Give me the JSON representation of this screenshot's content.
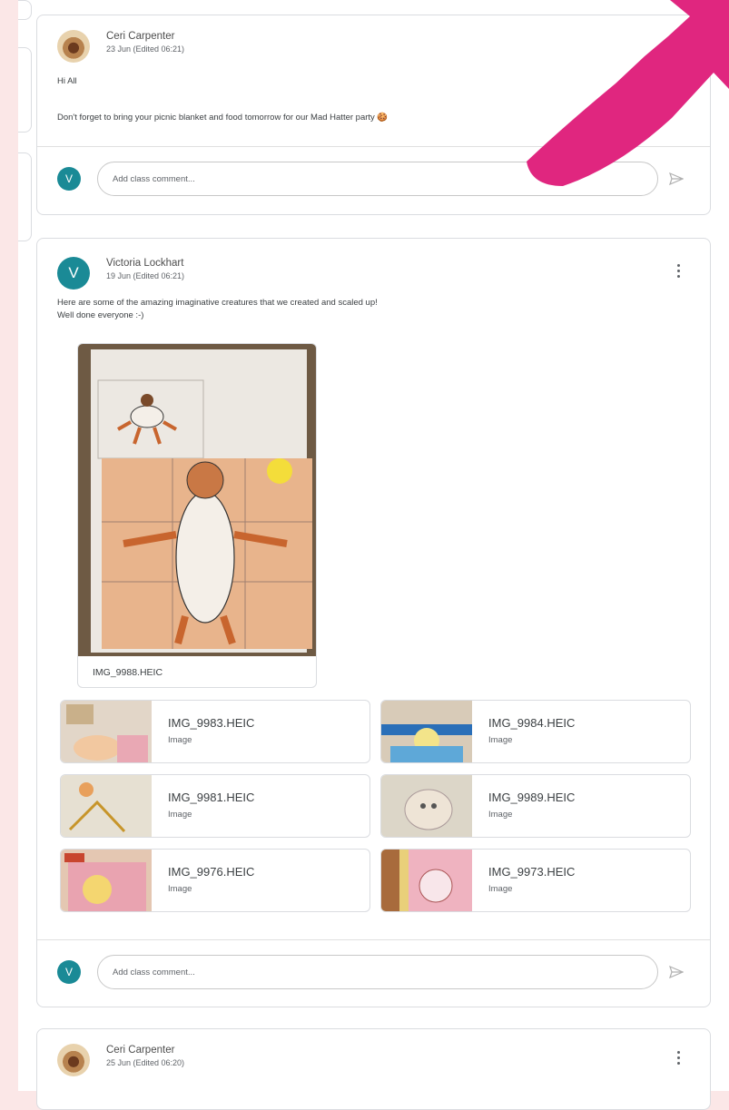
{
  "posts": [
    {
      "author": "Ceri Carpenter",
      "date": "23 Jun (Edited 06:21)",
      "lines": [
        "Hi All",
        "Don't forget to bring your picnic blanket and food tomorrow for our Mad Hatter party 🍪"
      ]
    },
    {
      "author": "Victoria Lockhart",
      "avatar_letter": "V",
      "date": "19 Jun (Edited 06:21)",
      "lines": [
        "Here are some of the amazing imaginative creatures that we created and scaled up!",
        "Well done everyone :-)"
      ],
      "main_attachment": "IMG_9988.HEIC",
      "attachments": [
        {
          "name": "IMG_9983.HEIC",
          "kind": "Image"
        },
        {
          "name": "IMG_9984.HEIC",
          "kind": "Image"
        },
        {
          "name": "IMG_9981.HEIC",
          "kind": "Image"
        },
        {
          "name": "IMG_9989.HEIC",
          "kind": "Image"
        },
        {
          "name": "IMG_9976.HEIC",
          "kind": "Image"
        },
        {
          "name": "IMG_9973.HEIC",
          "kind": "Image"
        }
      ]
    },
    {
      "author": "Ceri Carpenter",
      "date": "25 Jun (Edited 06:20)"
    }
  ],
  "comment": {
    "avatar_letter": "V",
    "placeholder": "Add class comment..."
  },
  "colors": {
    "teal": "#1a8a96",
    "arrow": "#e0267f",
    "background": "#fbe7e7"
  },
  "icons": [
    "more-vert-icon",
    "send-icon"
  ]
}
